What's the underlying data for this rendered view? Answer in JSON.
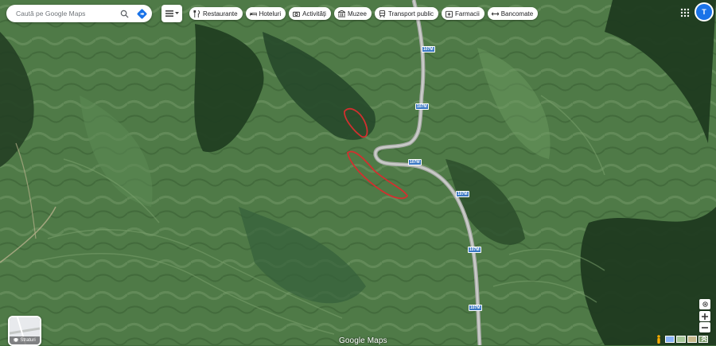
{
  "search": {
    "placeholder": "Caută pe Google Maps"
  },
  "chips": [
    {
      "label": "Restaurante",
      "icon": "fork-knife-icon"
    },
    {
      "label": "Hoteluri",
      "icon": "bed-icon"
    },
    {
      "label": "Activități",
      "icon": "camera-icon"
    },
    {
      "label": "Muzee",
      "icon": "museum-icon"
    },
    {
      "label": "Transport public",
      "icon": "train-icon"
    },
    {
      "label": "Farmacii",
      "icon": "pharmacy-icon"
    },
    {
      "label": "Bancomate",
      "icon": "atm-icon"
    }
  ],
  "account": {
    "initial": "T"
  },
  "layers": {
    "label": "Straturi"
  },
  "brand": {
    "logo": "Google Maps"
  },
  "road": {
    "number": "107M"
  },
  "colors": {
    "accent": "#1a73e8",
    "marking": "#d32f2f",
    "road": "#9aa0a6"
  }
}
